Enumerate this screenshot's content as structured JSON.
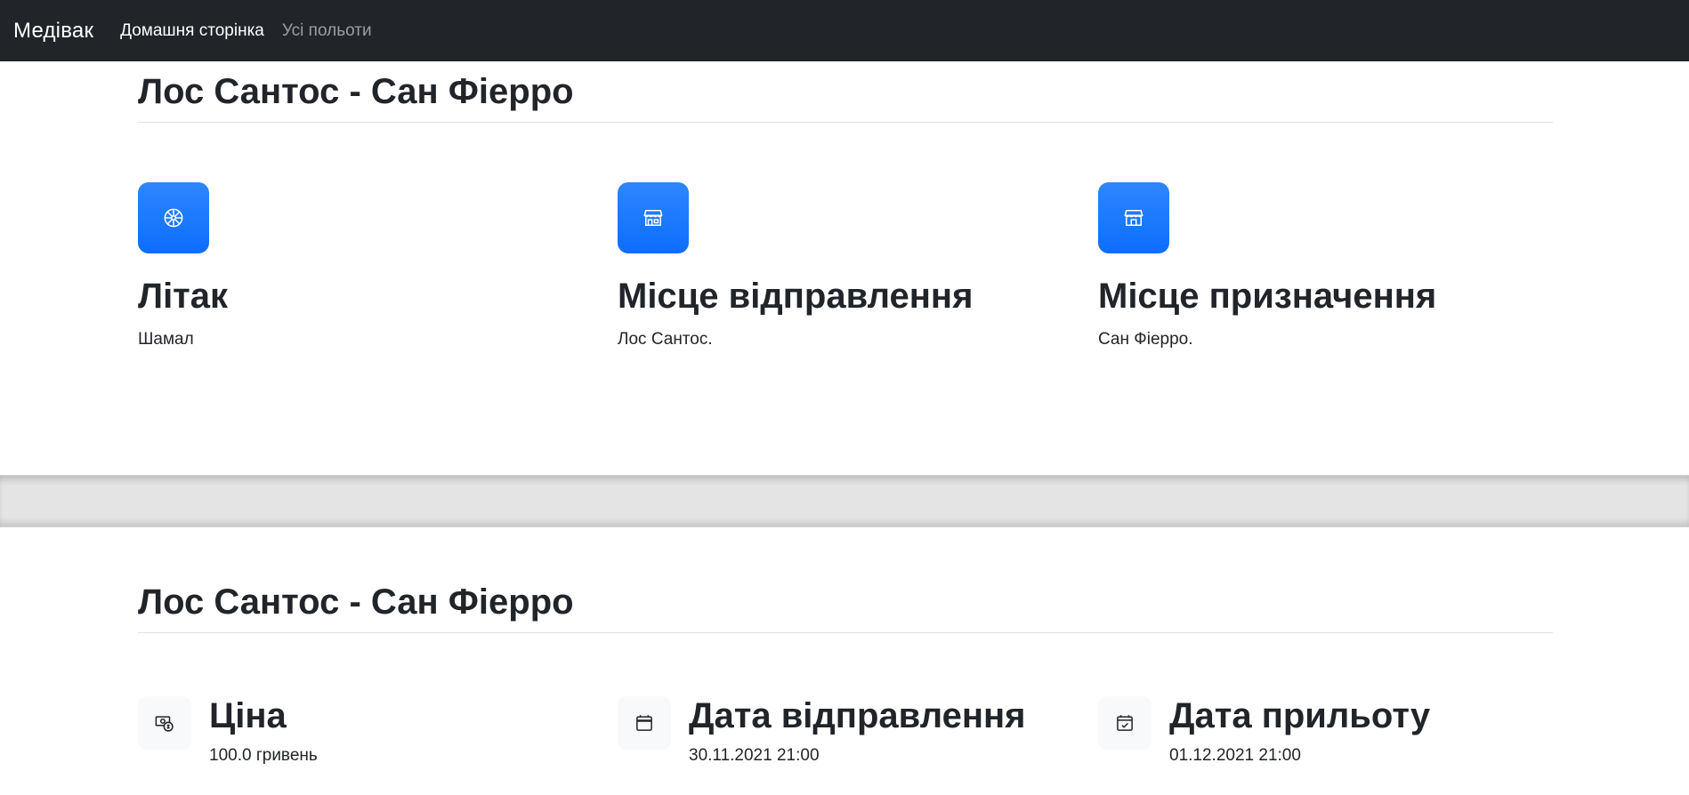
{
  "navbar": {
    "brand": "Медівак",
    "links": [
      {
        "label": "Домашня сторінка",
        "active": true
      },
      {
        "label": "Усі польоти",
        "active": false
      }
    ]
  },
  "section1": {
    "heading": "Лос Сантос - Сан Фіерро",
    "features": [
      {
        "icon": "aircraft-wheel-icon",
        "title": "Літак",
        "text": "Шамал"
      },
      {
        "icon": "shop-icon",
        "title": "Місце відправлення",
        "text": "Лос Сантос."
      },
      {
        "icon": "shop-icon",
        "title": "Місце призначення",
        "text": "Сан Фіерро."
      }
    ]
  },
  "section2": {
    "heading": "Лос Сантос - Сан Фіерро",
    "items": [
      {
        "icon": "cash-coin-icon",
        "title": "Ціна",
        "text": "100.0 гривень"
      },
      {
        "icon": "calendar-icon",
        "title": "Дата відправлення",
        "text": "30.11.2021 21:00"
      },
      {
        "icon": "calendar-check-icon",
        "title": "Дата прильоту",
        "text": "01.12.2021 21:00"
      }
    ]
  },
  "colors": {
    "navbar_bg": "#212529",
    "accent": "#0d6efd",
    "band_bg": "#e4e4e4",
    "icon_light_bg": "#f8f9fa"
  }
}
